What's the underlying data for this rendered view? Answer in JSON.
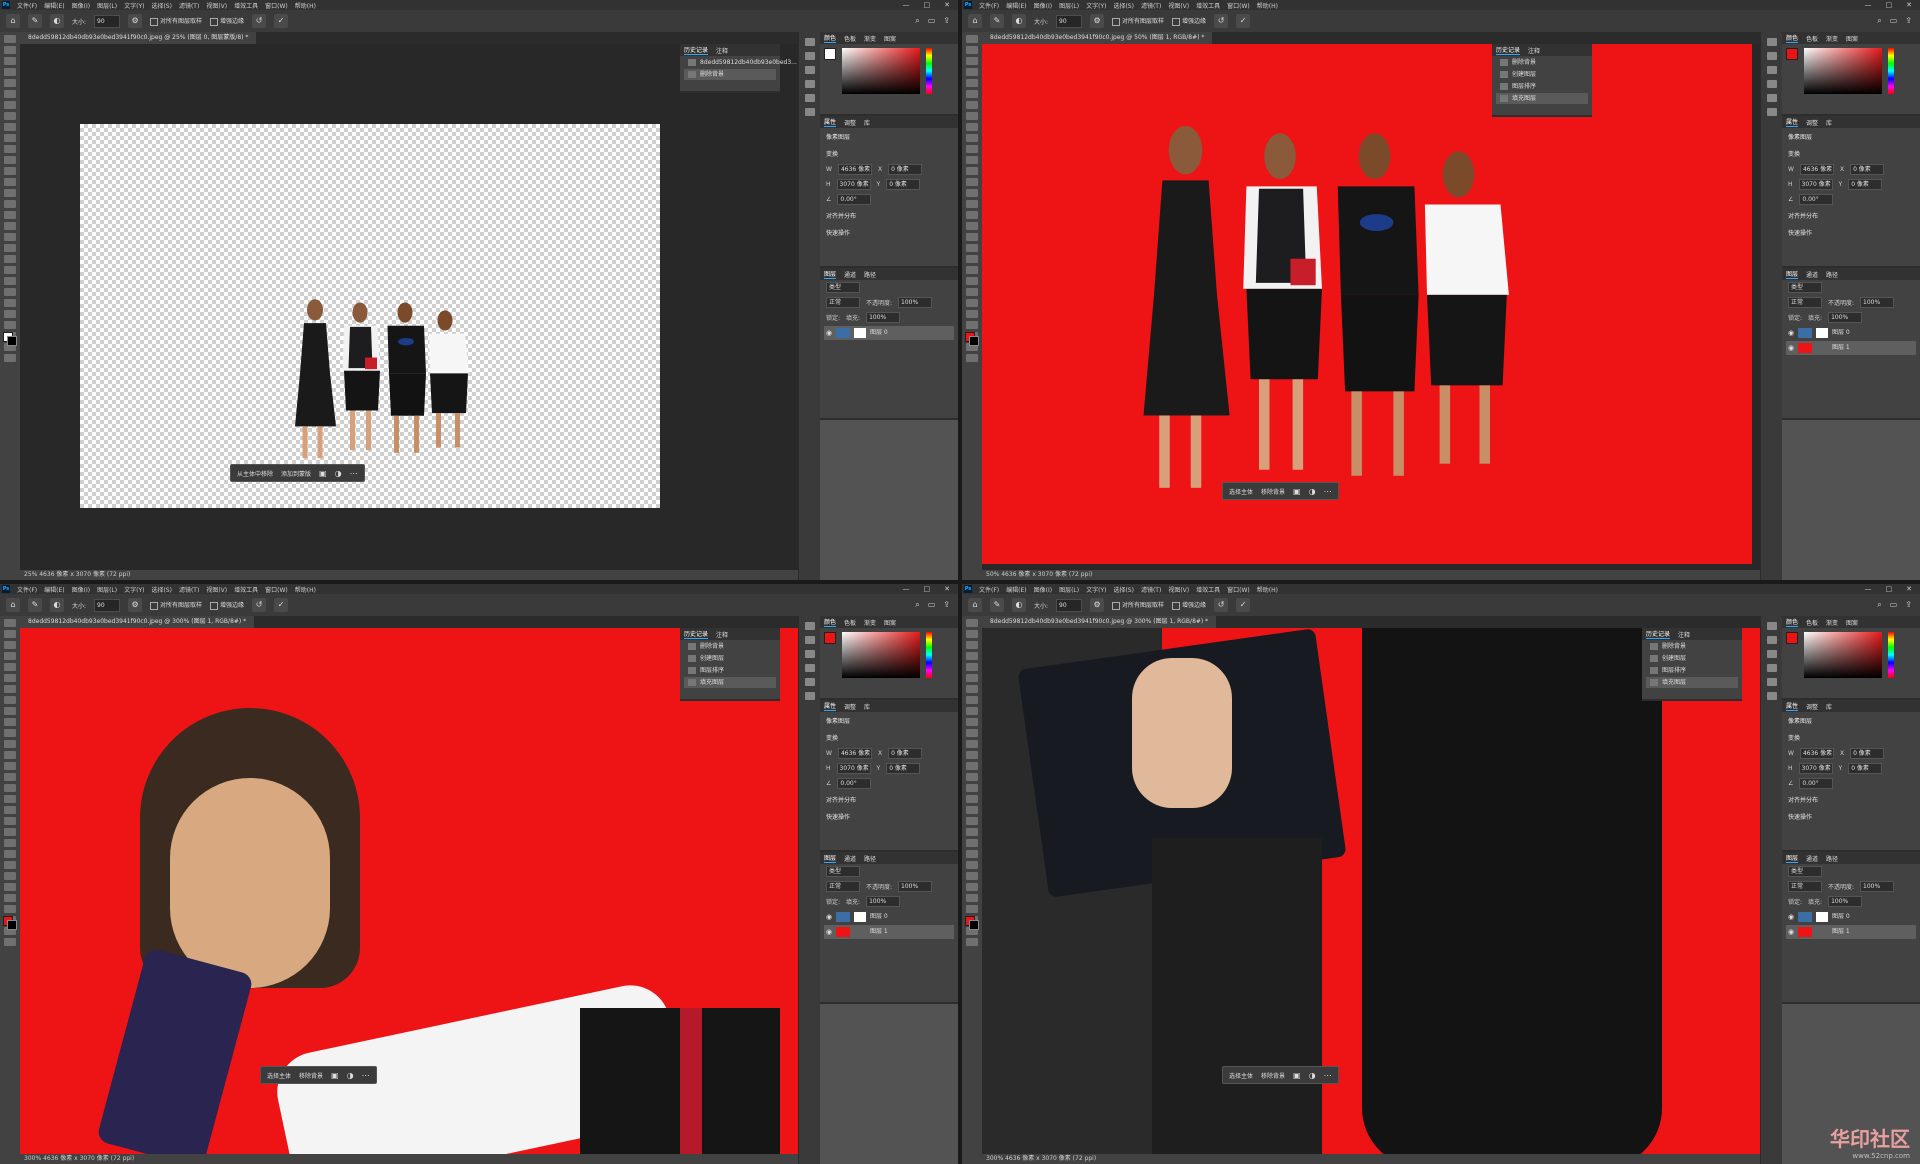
{
  "menu": {
    "items": [
      "文件(F)",
      "编辑(E)",
      "图像(I)",
      "图层(L)",
      "文字(Y)",
      "选择(S)",
      "滤镜(T)",
      "视图(V)",
      "增效工具",
      "窗口(W)",
      "帮助(H)"
    ],
    "window_controls": [
      "—",
      "□",
      "✕"
    ]
  },
  "options": {
    "size_label": "大小:",
    "size_value": "90",
    "sample_all": "对所有图层取样",
    "auto_enhance": "增强边缘"
  },
  "quadrants": [
    {
      "tab": "8dedd59812db40db93e0bed3941f90c0.jpeg @ 25% (图层 0, 图层蒙版/8) *",
      "status": "25%   4636 像素 x 3070 像素 (72 ppi)",
      "ctx": [
        "从主体中移除",
        "添加到蒙版"
      ],
      "history": {
        "title": "历史记录",
        "tab2": "注释",
        "items": [
          "8dedd59812db40db93e0bed3...",
          "删除背景"
        ]
      },
      "layers": [
        {
          "name": "图层 0",
          "type": "photo"
        }
      ]
    },
    {
      "tab": "8dedd59812db40db93e0bed3941f90c0.jpeg @ 50% (图层 1, RGB/8#) *",
      "status": "50%   4636 像素 x 3070 像素 (72 ppi)",
      "ctx": [
        "选择主体",
        "移除背景"
      ],
      "history": {
        "title": "历史记录",
        "tab2": "注释",
        "items": [
          "删除背景",
          "创建图层",
          "图层排序",
          "填充图层"
        ]
      },
      "layers": [
        {
          "name": "图层 0",
          "type": "photo"
        },
        {
          "name": "图层 1",
          "type": "red"
        }
      ]
    },
    {
      "tab": "8dedd59812db40db93e0bed3941f90c0.jpeg @ 300% (图层 1, RGB/8#) *",
      "status": "300%   4636 像素 x 3070 像素 (72 ppi)",
      "ctx": [
        "选择主体",
        "移除背景"
      ],
      "history": {
        "title": "历史记录",
        "tab2": "注释",
        "items": [
          "删除背景",
          "创建图层",
          "图层排序",
          "填充图层"
        ]
      },
      "layers": [
        {
          "name": "图层 0",
          "type": "photo"
        },
        {
          "name": "图层 1",
          "type": "red"
        }
      ]
    },
    {
      "tab": "8dedd59812db40db93e0bed3941f90c0.jpeg @ 300% (图层 1, RGB/8#) *",
      "status": "300%   4636 像素 x 3070 像素 (72 ppi)",
      "ctx": [
        "选择主体",
        "移除背景"
      ],
      "history": {
        "title": "历史记录",
        "tab2": "注释",
        "items": [
          "删除背景",
          "创建图层",
          "图层排序",
          "填充图层"
        ]
      },
      "layers": [
        {
          "name": "图层 0",
          "type": "photo"
        },
        {
          "name": "图层 1",
          "type": "red"
        }
      ]
    }
  ],
  "panels": {
    "color_tabs": [
      "颜色",
      "色板",
      "渐变",
      "图案"
    ],
    "props_tabs": [
      "属性",
      "调整",
      "库"
    ],
    "props_layer": "像素图层",
    "transform": "变换",
    "w_value": "4636 像素",
    "h_value": "3070 像素",
    "x_value": "0 像素",
    "y_value": "0 像素",
    "angle": "0.00°",
    "align": "对齐并分布",
    "quick": "快速操作",
    "layers_tabs": [
      "图层",
      "通道",
      "路径"
    ],
    "kind": "类型",
    "blend": "正常",
    "opacity_label": "不透明度:",
    "opacity": "100%",
    "fill_label": "填充:",
    "fill": "100%",
    "lock_label": "锁定:"
  },
  "watermark": {
    "title": "华印社区",
    "url": "www.52cnp.com"
  },
  "colors": {
    "red": "#ee1416",
    "accent": "#31a8ff"
  }
}
